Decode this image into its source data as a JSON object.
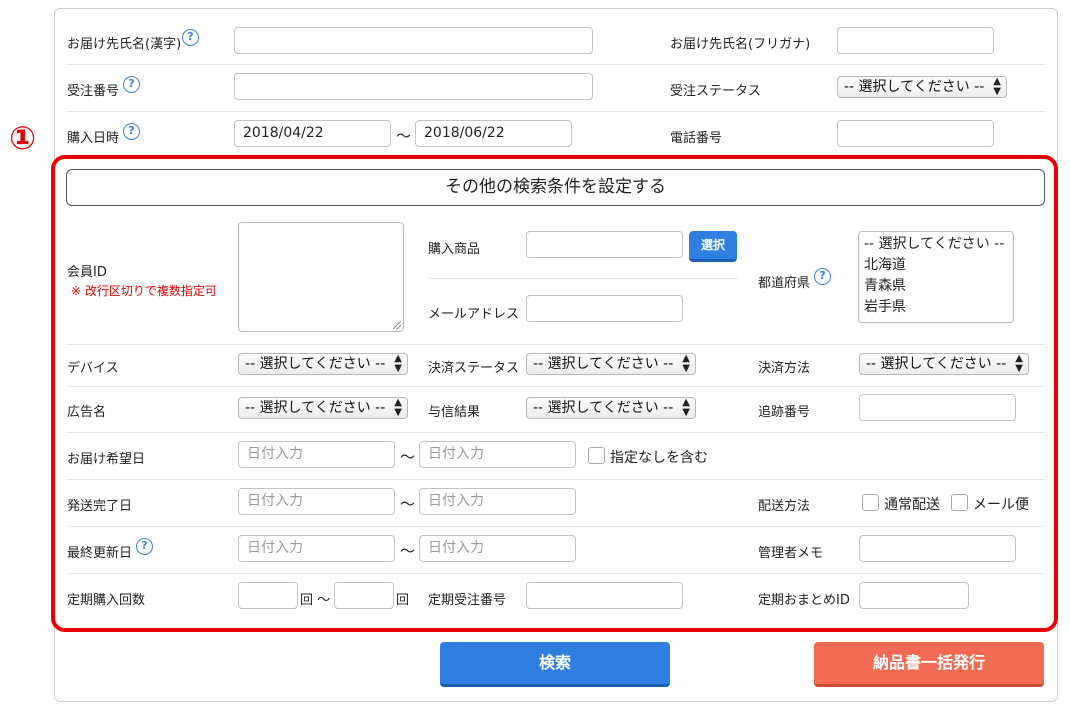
{
  "top_rows": {
    "recipient_name_kanji_label": "お届け先氏名(漢字)",
    "recipient_name_kana_label": "お届け先氏名(フリガナ)",
    "order_number_label": "受注番号",
    "order_status_label": "受注ステータス",
    "order_status_value": "-- 選択してください --",
    "purchase_date_label": "購入日時",
    "purchase_date_from": "2018/04/22",
    "purchase_date_to": "2018/06/22",
    "range_separator": "～",
    "phone_label": "電話番号"
  },
  "callout_number": "①",
  "other_conditions_toggle": "その他の検索条件を設定する",
  "member": {
    "label": "会員ID",
    "note": "※ 改行区切りで複数指定可"
  },
  "product": {
    "label": "購入商品",
    "select_button": "選択"
  },
  "email_label": "メールアドレス",
  "prefecture": {
    "label": "都道府県",
    "options": [
      "-- 選択してください --",
      "北海道",
      "青森県",
      "岩手県"
    ]
  },
  "device": {
    "label": "デバイス",
    "value": "-- 選択してください --"
  },
  "payment_status": {
    "label": "決済ステータス",
    "value": "-- 選択してください --"
  },
  "payment_method": {
    "label": "決済方法",
    "value": "-- 選択してください --"
  },
  "ad": {
    "label": "広告名",
    "value": "-- 選択してください --"
  },
  "credit_result": {
    "label": "与信結果",
    "value": "-- 選択してください --"
  },
  "tracking_label": "追跡番号",
  "date_placeholder": "日付入力",
  "delivery_date": {
    "label": "お届け希望日",
    "include_none_label": "指定なしを含む"
  },
  "ship_complete_label": "発送完了日",
  "shipping_method": {
    "label": "配送方法",
    "normal": "通常配送",
    "mail": "メール便"
  },
  "last_updated_label": "最終更新日",
  "admin_memo_label": "管理者メモ",
  "subscription_count": {
    "label": "定期購入回数",
    "unit_from": "回 ～",
    "unit_to": "回"
  },
  "subscription_order_label": "定期受注番号",
  "subscription_bundle_label": "定期おまとめID",
  "buttons": {
    "search": "検索",
    "bulk_issue": "納品書一括発行"
  },
  "help_glyph": "?",
  "colors": {
    "accent_blue": "#2f7fe0",
    "highlight_red": "#ea0000",
    "issue_orange": "#f26a52"
  }
}
